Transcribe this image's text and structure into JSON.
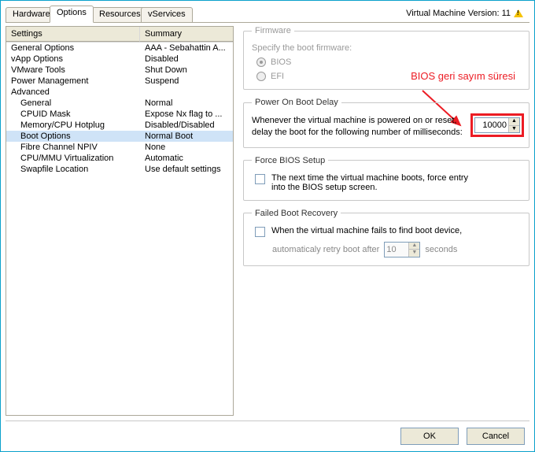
{
  "tabs": {
    "hardware": "Hardware",
    "options": "Options",
    "resources": "Resources",
    "vservices": "vServices"
  },
  "version_label": "Virtual Machine Version: 11",
  "left": {
    "head": {
      "settings": "Settings",
      "summary": "Summary"
    },
    "rows": [
      {
        "name": "General Options",
        "sum": "AAA - Sebahattin A...",
        "indent": 0
      },
      {
        "name": "vApp Options",
        "sum": "Disabled",
        "indent": 0
      },
      {
        "name": "VMware Tools",
        "sum": "Shut Down",
        "indent": 0
      },
      {
        "name": "Power Management",
        "sum": "Suspend",
        "indent": 0
      },
      {
        "name": "Advanced",
        "sum": "",
        "indent": 0
      },
      {
        "name": "General",
        "sum": "Normal",
        "indent": 1
      },
      {
        "name": "CPUID Mask",
        "sum": "Expose Nx flag to ...",
        "indent": 1
      },
      {
        "name": "Memory/CPU Hotplug",
        "sum": "Disabled/Disabled",
        "indent": 1
      },
      {
        "name": "Boot Options",
        "sum": "Normal Boot",
        "indent": 1,
        "selected": true
      },
      {
        "name": "Fibre Channel NPIV",
        "sum": "None",
        "indent": 1
      },
      {
        "name": "CPU/MMU Virtualization",
        "sum": "Automatic",
        "indent": 1
      },
      {
        "name": "Swapfile Location",
        "sum": "Use default settings",
        "indent": 1
      }
    ]
  },
  "firmware": {
    "legend": "Firmware",
    "specify": "Specify the boot firmware:",
    "bios": "BIOS",
    "efi": "EFI"
  },
  "bootdelay": {
    "legend": "Power On Boot Delay",
    "text1": "Whenever the virtual machine is powered on or reset,",
    "text2": "delay the boot for the following number of milliseconds:",
    "value": "10000"
  },
  "forcebios": {
    "legend": "Force BIOS Setup",
    "text": "The next time the virtual machine boots, force entry into the BIOS setup screen."
  },
  "failed": {
    "legend": "Failed Boot Recovery",
    "text": "When the virtual machine fails to find boot device,",
    "retry": "automaticaly retry boot after",
    "value": "10",
    "seconds": "seconds"
  },
  "annotation": "BIOS geri sayım süresi",
  "buttons": {
    "ok": "OK",
    "cancel": "Cancel"
  }
}
